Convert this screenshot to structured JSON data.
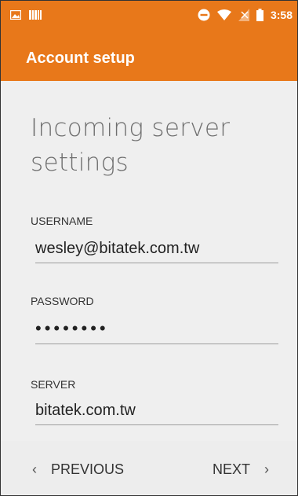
{
  "status_bar": {
    "time": "3:58",
    "left_icons": [
      "image-icon",
      "barcode-icon"
    ],
    "right_icons": [
      "do-not-disturb-icon",
      "wifi-icon",
      "no-sim-icon",
      "battery-icon"
    ]
  },
  "app_bar": {
    "title": "Account setup",
    "color": "#e8781a"
  },
  "heading": "Incoming server settings",
  "fields": [
    {
      "label": "USERNAME",
      "value": "wesley@bitatek.com.tw"
    },
    {
      "label": "PASSWORD",
      "value": "••••••••"
    },
    {
      "label": "SERVER",
      "value": "bitatek.com.tw"
    }
  ],
  "nav": {
    "previous_label": "PREVIOUS",
    "next_label": "NEXT",
    "previous_chevron": "‹",
    "next_chevron": "›"
  }
}
